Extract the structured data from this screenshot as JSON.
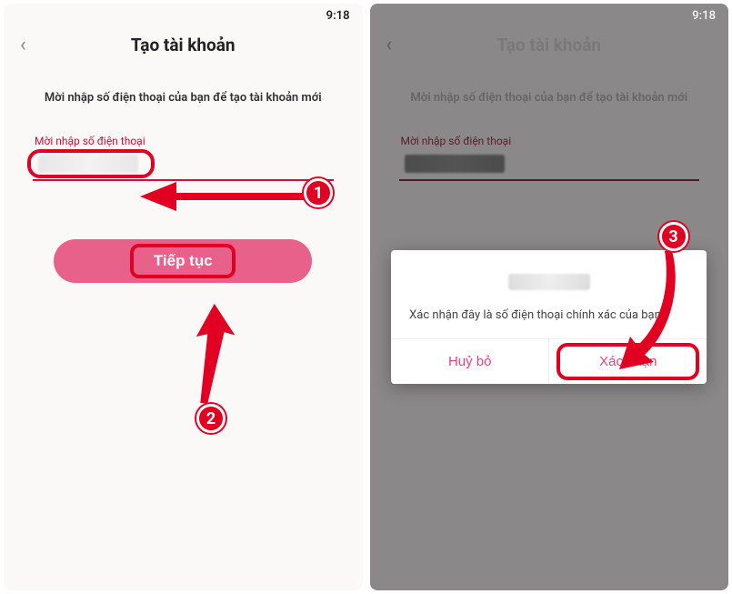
{
  "status_time": "9:18",
  "screen_a": {
    "title": "Tạo tài khoản",
    "instruction": "Mời nhập số điện thoại của bạn để tạo tài khoản mới",
    "phone_label": "Mời nhập số điện thoại",
    "phone_value": "",
    "continue_label": "Tiếp tục"
  },
  "screen_b": {
    "title": "Tạo tài khoản",
    "instruction": "Mời nhập số điện thoại của bạn để tạo tài khoản mới",
    "phone_label": "Mời nhập số điện thoại",
    "dialog": {
      "message": "Xác nhận đây là số điện thoại chính xác của bạn",
      "cancel_label": "Huỷ bỏ",
      "confirm_label": "Xác nhận"
    }
  },
  "annotations": {
    "step1": "1",
    "step2": "2",
    "step3": "3"
  },
  "colors": {
    "accent": "#e20022",
    "button": "#e8618a",
    "link": "#e8447a"
  }
}
